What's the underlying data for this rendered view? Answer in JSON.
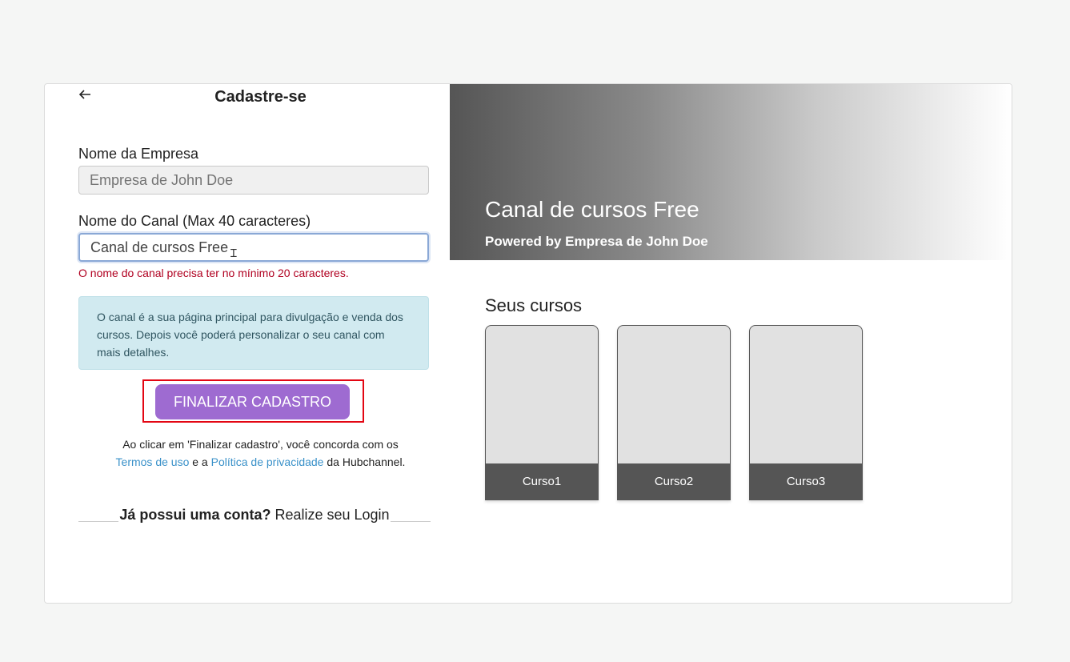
{
  "form": {
    "title": "Cadastre-se",
    "company_label": "Nome da Empresa",
    "company_placeholder": "Empresa de John Doe",
    "channel_label": "Nome do Canal (Max 40 caracteres)",
    "channel_value": "Canal de cursos Free",
    "error": "O nome do canal precisa ter no mínimo 20 caracteres.",
    "info": "O canal é a sua página principal para divulgação e venda dos cursos. Depois você poderá personalizar o seu canal com mais detalhes.",
    "submit_label": "FINALIZAR CADASTRO",
    "terms_prefix": "Ao clicar em 'Finalizar cadastro', você concorda com os",
    "terms_link": "Termos de uso",
    "terms_mid": "e a",
    "privacy_link": "Política de privacidade",
    "terms_suffix": "da Hubchannel.",
    "login_question": "Já possui uma conta?",
    "login_link": "Realize seu Login"
  },
  "preview": {
    "channel_name": "Canal de cursos Free",
    "powered_by": "Powered by Empresa de John Doe",
    "courses_title": "Seus cursos",
    "courses": [
      "Curso1",
      "Curso2",
      "Curso3"
    ]
  },
  "colors": {
    "accent": "#9e6bd1",
    "error": "#b00020",
    "link": "#3a91c9",
    "highlight": "#e30613"
  }
}
